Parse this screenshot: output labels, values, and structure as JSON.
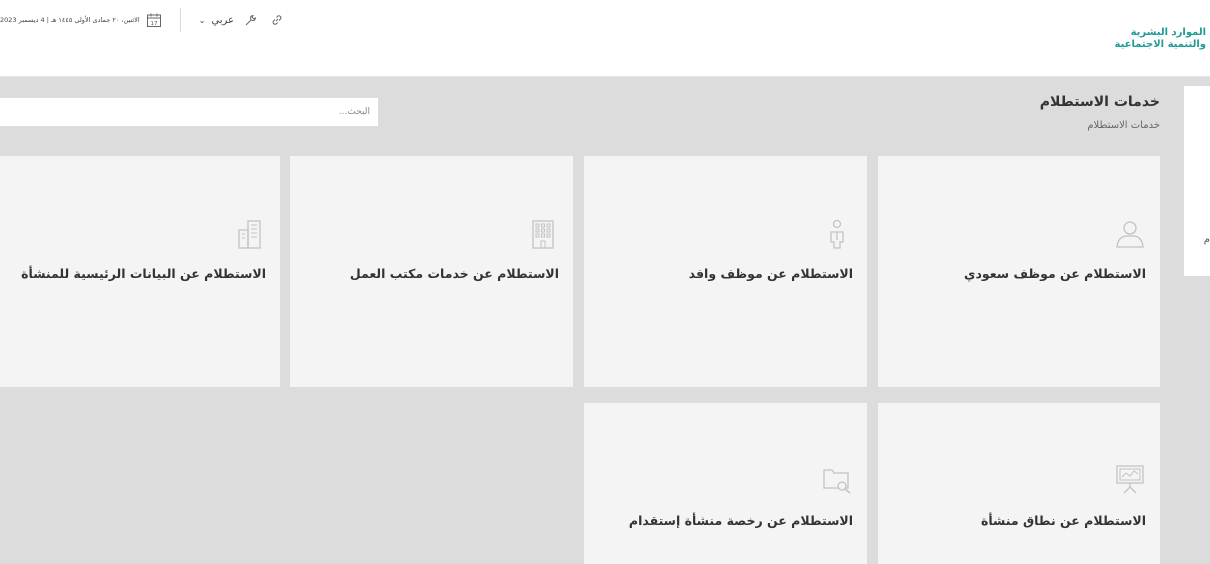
{
  "header": {
    "logo_line1": "الموارد البشرية",
    "logo_line2": "والتنمية الاجتماعية",
    "date_text": "الاثنين، ٢٠ جمادى الأولى ١٤٤٥ هـ | 4 ديسمبر 2023",
    "calendar_day": "17",
    "language_label": "عربي"
  },
  "page": {
    "title": "خدمات الاستطلام",
    "breadcrumb": "خدمات الاستطلام",
    "search_placeholder": "البحث..."
  },
  "side_panel": {
    "partial_text": "م"
  },
  "cards": [
    {
      "label": "الاستطلام عن موظف سعودي",
      "icon": "person-icon"
    },
    {
      "label": "الاستطلام عن موظف وافد",
      "icon": "employee-icon"
    },
    {
      "label": "الاستطلام عن خدمات مكتب العمل",
      "icon": "building-icon"
    },
    {
      "label": "الاستطلام عن البيانات الرئيسية للمنشأة",
      "icon": "buildings-icon"
    },
    {
      "label": "الاستطلام عن نطاق منشأة",
      "icon": "presentation-chart-icon"
    },
    {
      "label": "الاستطلام عن رخصة منشأة إستقدام",
      "icon": "folder-search-icon"
    }
  ],
  "colors": {
    "brand": "#1f9c95",
    "background": "#dcdcdc",
    "card": "#f4f4f4"
  }
}
